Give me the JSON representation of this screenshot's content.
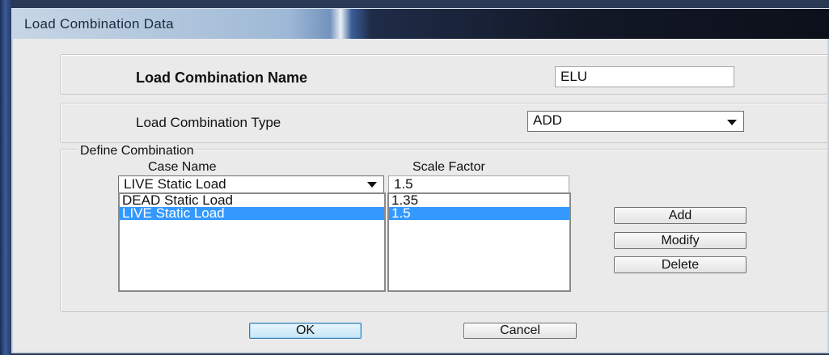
{
  "window": {
    "title": "Load Combination Data"
  },
  "name_section": {
    "label": "Load Combination Name",
    "value": "ELU"
  },
  "type_section": {
    "label": "Load Combination Type",
    "selected": "ADD"
  },
  "define": {
    "legend": "Define Combination",
    "case_header": "Case Name",
    "scale_header": "Scale Factor",
    "case_combo_value": "LIVE Static Load",
    "scale_input_value": "1.5",
    "rows": [
      {
        "case": "DEAD Static Load",
        "scale": "1.35",
        "selected": false
      },
      {
        "case": "LIVE Static Load",
        "scale": "1.5",
        "selected": true
      }
    ],
    "buttons": {
      "add": "Add",
      "modify": "Modify",
      "delete": "Delete"
    }
  },
  "footer": {
    "ok": "OK",
    "cancel": "Cancel"
  },
  "colors": {
    "selection": "#3399ff",
    "dialog_bg": "#eaeaea"
  }
}
